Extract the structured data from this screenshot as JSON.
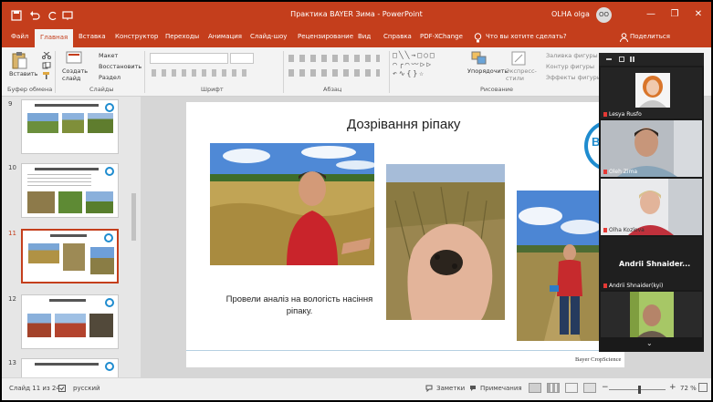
{
  "window": {
    "title": "Практика BAYER Зима - PowerPoint",
    "user_name": "OLHA olga",
    "user_initials": "OO",
    "minimize_glyph": "—",
    "restore_glyph": "❐",
    "close_glyph": "✕"
  },
  "tabs": [
    "Файл",
    "Главная",
    "Вставка",
    "Конструктор",
    "Переходы",
    "Анимация",
    "Слайд-шоу",
    "Рецензирование",
    "Вид",
    "Справка",
    "PDF-XChange"
  ],
  "active_tab": "Главная",
  "tell_me": "Что вы хотите сделать?",
  "share_label": "Поделиться",
  "ribbon": {
    "clipboard": {
      "paste": "Вставить",
      "label": "Буфер обмена"
    },
    "slides": {
      "new_slide": "Создать слайд",
      "layout": "Макет",
      "reset": "Восстановить",
      "section": "Раздел",
      "label": "Слайды"
    },
    "font": {
      "label": "Шрифт"
    },
    "paragraph": {
      "label": "Абзац"
    },
    "drawing": {
      "arrange": "Упорядочить",
      "quick_styles": "Экспресс-стили",
      "fill": "Заливка фигуры",
      "outline": "Контур фигуры",
      "effects": "Эффекты фигуры",
      "label": "Рисование"
    }
  },
  "thumbnails": [
    {
      "number": "9",
      "selected": false
    },
    {
      "number": "10",
      "selected": false
    },
    {
      "number": "11",
      "selected": true
    },
    {
      "number": "12",
      "selected": false
    },
    {
      "number": "13",
      "selected": false
    }
  ],
  "slide": {
    "title": "Дозрівання ріпаку",
    "caption": "Провели аналіз на вологість насіння ріпаку.",
    "footer": "Bayer CropScience",
    "logo_letter": "B"
  },
  "zoom_panel": {
    "participants": [
      {
        "name": "Lesya Rusfo"
      },
      {
        "name": "Oleh Zima"
      },
      {
        "name": "Olha Kozlova"
      },
      {
        "name": "Andrii Shnaider...",
        "video_off": true
      },
      {
        "name": "Andrii Shnaider(kyi)"
      }
    ]
  },
  "status": {
    "slide_counter": "Слайд 11 из 24",
    "language": "русский",
    "notes": "Заметки",
    "comments": "Примечания",
    "zoom_level": "72 %"
  },
  "colors": {
    "accent": "#c43e1c",
    "bayer_blue": "#1f8ccf"
  },
  "icons": [
    "save-icon",
    "undo-icon",
    "redo-icon",
    "start-slideshow-icon",
    "paste-icon",
    "new-slide-icon",
    "lightbulb-icon",
    "person-icon",
    "notes-icon",
    "comments-icon",
    "normal-view-icon",
    "sorter-view-icon",
    "reading-view-icon",
    "slideshow-view-icon",
    "fit-slide-icon",
    "mic-muted-icon",
    "scroll-down-icon"
  ]
}
